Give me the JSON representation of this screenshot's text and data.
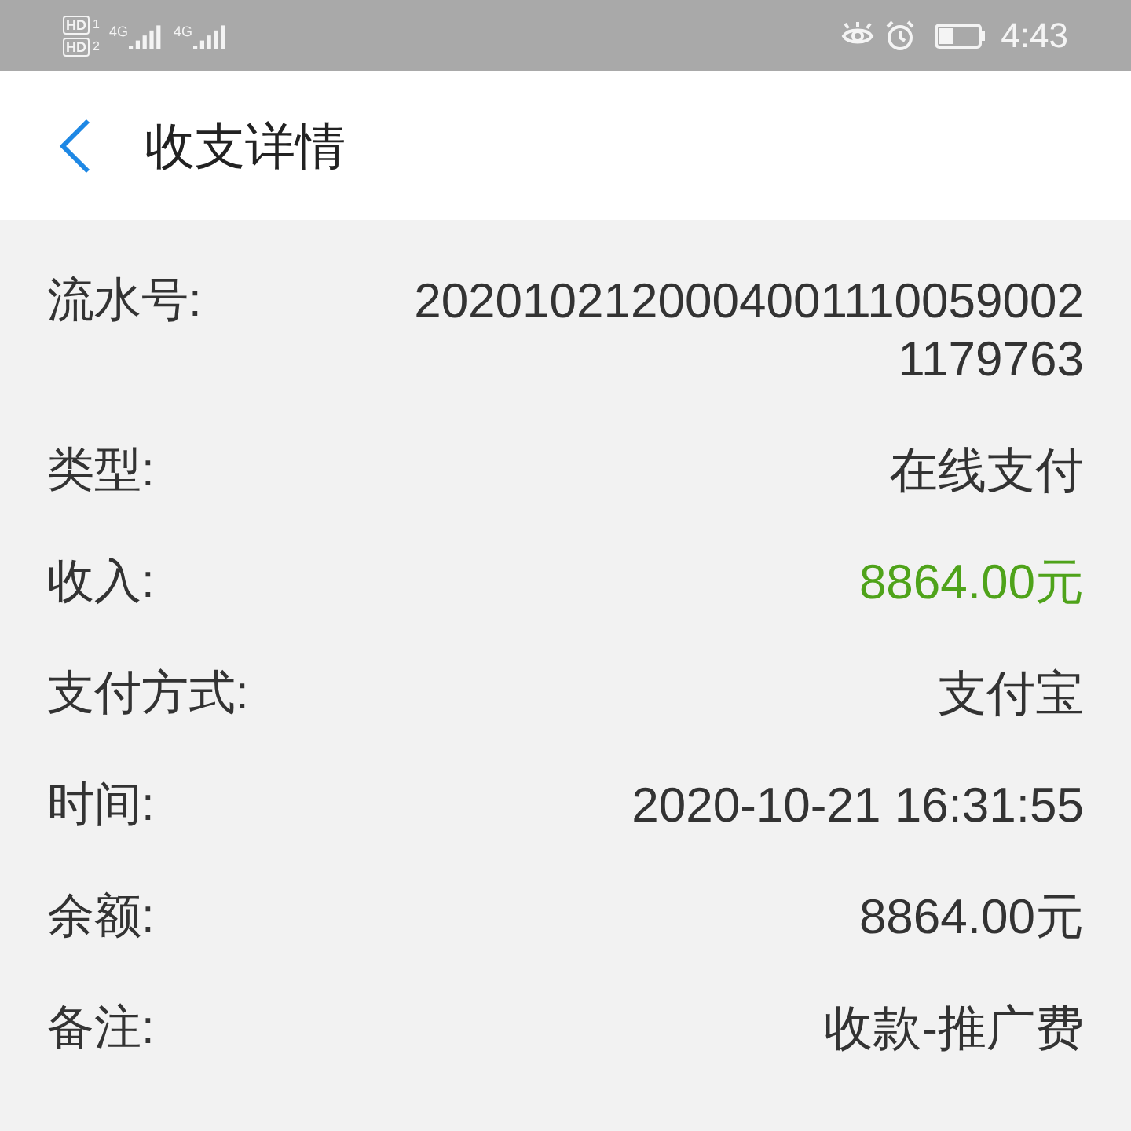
{
  "status_bar": {
    "sims": [
      {
        "badge": "HD",
        "slot": "1",
        "network": "4G"
      },
      {
        "badge": "HD",
        "slot": "2",
        "network": "4G"
      }
    ],
    "time": "4:43"
  },
  "header": {
    "title": "收支详情"
  },
  "details": [
    {
      "label": "流水号:",
      "value": "20201021200040011100590021179763",
      "kind": "plain"
    },
    {
      "label": "类型:",
      "value": "在线支付",
      "kind": "plain"
    },
    {
      "label": "收入:",
      "value": "8864.00元",
      "kind": "income"
    },
    {
      "label": "支付方式:",
      "value": "支付宝",
      "kind": "plain"
    },
    {
      "label": "时间:",
      "value": "2020-10-21 16:31:55",
      "kind": "plain"
    },
    {
      "label": "余额:",
      "value": "8864.00元",
      "kind": "plain"
    },
    {
      "label": "备注:",
      "value": "收款-推广费",
      "kind": "plain"
    }
  ]
}
